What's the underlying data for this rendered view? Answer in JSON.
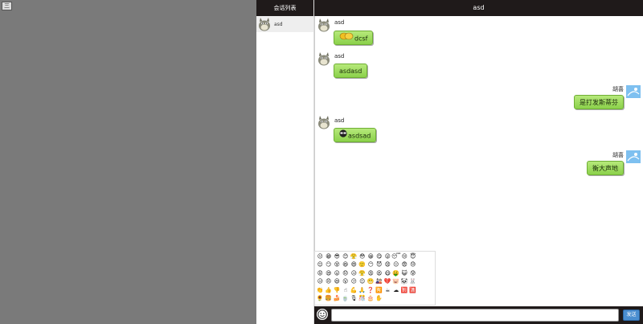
{
  "left_panel": {
    "toggle_label": "三"
  },
  "conversation_list": {
    "title": "会话列表",
    "items": [
      {
        "name": "asd"
      }
    ]
  },
  "chat": {
    "title": "asd",
    "messages": [
      {
        "sender": "asd",
        "side": "left",
        "text": "dcsf",
        "emoji": "handshake-emoji-icon"
      },
      {
        "sender": "asd",
        "side": "left",
        "text": "asdasd"
      },
      {
        "sender": "胡喜",
        "side": "right",
        "text": "是打发斯蒂芬"
      },
      {
        "sender": "asd",
        "side": "left",
        "text": "asdsad",
        "emoji": "sunglasses-emoji-icon"
      },
      {
        "sender": "胡喜",
        "side": "right",
        "text": "衡大声地"
      }
    ]
  },
  "emoji_panel": {
    "rows": [
      [
        "😐",
        "😁",
        "😎",
        "😊",
        "😤",
        "😳",
        "😀",
        "😋",
        "😜",
        "😴",
        "😒",
        "😇"
      ],
      [
        "😌",
        "😏",
        "😵",
        "😆",
        "😄",
        "🙂",
        "😶",
        "😈",
        "😧",
        "😑",
        "😨",
        "😓"
      ],
      [
        "😡",
        "😪",
        "😛",
        "😞",
        "😥",
        "😤",
        "😩",
        "😫",
        "😷",
        "🤑",
        "😺",
        "😰"
      ],
      [
        "😥",
        "😠",
        "😃",
        "😮",
        "😕",
        "😉",
        "😬",
        "🎎",
        "💔",
        "🐷",
        "🐼",
        "🐰"
      ],
      [
        "👏",
        "👍",
        "👎",
        "☝",
        "💪",
        "🙏",
        "❓",
        "🈶",
        "☕",
        "☁",
        "🈹",
        "🈵"
      ],
      [
        "🌻",
        "🍔",
        "🍰",
        "🍵",
        "🎙",
        "🎊",
        "🎂",
        "✋"
      ]
    ]
  },
  "input": {
    "placeholder": "",
    "value": "",
    "send_label": "发送"
  }
}
